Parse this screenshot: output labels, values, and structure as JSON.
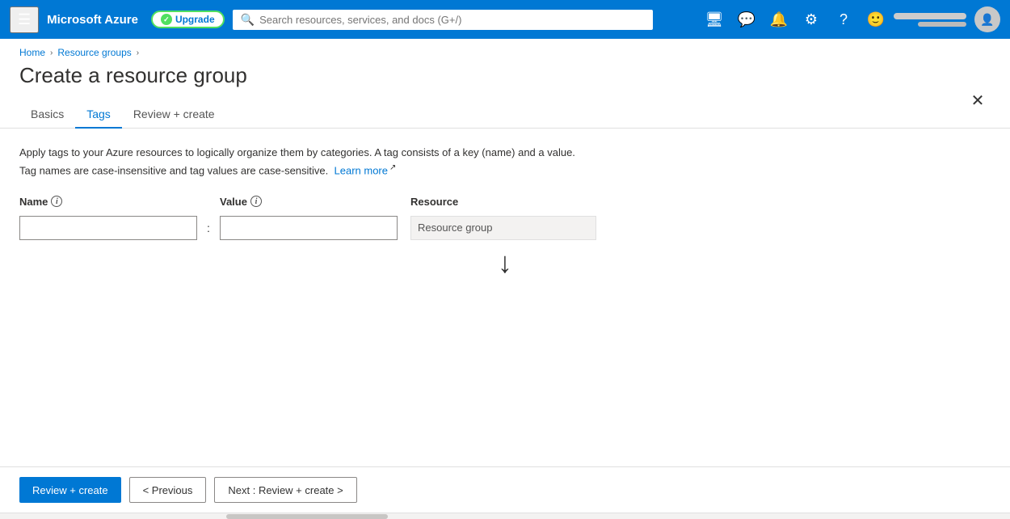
{
  "topnav": {
    "hamburger_label": "☰",
    "brand": "Microsoft Azure",
    "upgrade_label": "Upgrade",
    "search_placeholder": "Search resources, services, and docs (G+/)",
    "icons": [
      {
        "name": "cloud-shell-icon",
        "symbol": "⬛"
      },
      {
        "name": "feedback-icon",
        "symbol": "💬"
      },
      {
        "name": "notifications-icon",
        "symbol": "🔔"
      },
      {
        "name": "settings-icon",
        "symbol": "⚙"
      },
      {
        "name": "help-icon",
        "symbol": "?"
      },
      {
        "name": "smiley-icon",
        "symbol": "🙂"
      }
    ]
  },
  "breadcrumb": {
    "home": "Home",
    "resource_groups": "Resource groups"
  },
  "page": {
    "title": "Create a resource group",
    "description_line1": "Apply tags to your Azure resources to logically organize them by categories. A tag consists of a key (name) and a value.",
    "description_line2": "Tag names are case-insensitive and tag values are case-sensitive.",
    "learn_more": "Learn more"
  },
  "tabs": [
    {
      "label": "Basics",
      "active": false
    },
    {
      "label": "Tags",
      "active": true
    },
    {
      "label": "Review + create",
      "active": false
    }
  ],
  "form": {
    "name_label": "Name",
    "value_label": "Value",
    "resource_label": "Resource",
    "name_placeholder": "",
    "value_placeholder": "",
    "resource_value": "Resource group",
    "colon": ":"
  },
  "footer": {
    "review_create_label": "Review + create",
    "previous_label": "< Previous",
    "next_label": "Next : Review + create >"
  }
}
